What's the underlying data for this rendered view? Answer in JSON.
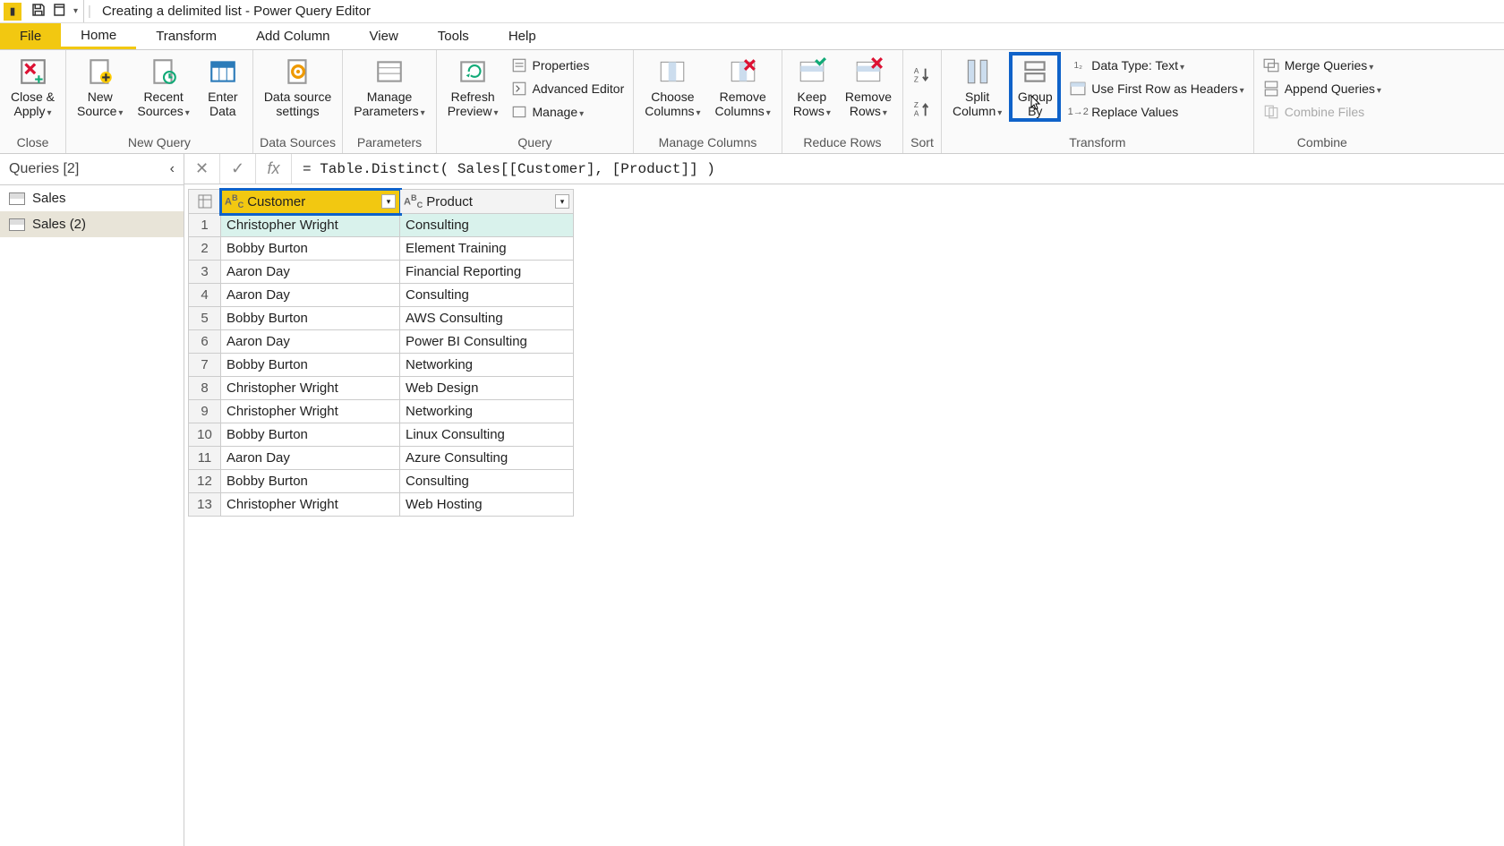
{
  "titlebar": {
    "title": "Creating a delimited list - Power Query Editor"
  },
  "tabs": {
    "file": "File",
    "home": "Home",
    "transform": "Transform",
    "addcolumn": "Add Column",
    "view": "View",
    "tools": "Tools",
    "help": "Help"
  },
  "ribbon": {
    "close": {
      "close_apply": "Close &\nApply",
      "group": "Close"
    },
    "newquery": {
      "new_source": "New\nSource",
      "recent_sources": "Recent\nSources",
      "enter_data": "Enter\nData",
      "group": "New Query"
    },
    "datasources": {
      "settings": "Data source\nsettings",
      "group": "Data Sources"
    },
    "parameters": {
      "manage": "Manage\nParameters",
      "group": "Parameters"
    },
    "query": {
      "refresh": "Refresh\nPreview",
      "properties": "Properties",
      "advanced": "Advanced Editor",
      "manage": "Manage",
      "group": "Query"
    },
    "managecols": {
      "choose": "Choose\nColumns",
      "remove": "Remove\nColumns",
      "group": "Manage Columns"
    },
    "reducerows": {
      "keep": "Keep\nRows",
      "remove": "Remove\nRows",
      "group": "Reduce Rows"
    },
    "sort": {
      "group": "Sort"
    },
    "transform": {
      "split": "Split\nColumn",
      "groupby": "Group\nBy",
      "datatype": "Data Type: Text",
      "firstrow": "Use First Row as Headers",
      "replace": "Replace Values",
      "group": "Transform"
    },
    "combine": {
      "merge": "Merge Queries",
      "append": "Append Queries",
      "files": "Combine Files",
      "group": "Combine"
    }
  },
  "formula": "= Table.Distinct( Sales[[Customer], [Product]] )",
  "sidebar": {
    "header": "Queries [2]",
    "items": [
      "Sales",
      "Sales (2)"
    ]
  },
  "grid": {
    "columns": [
      {
        "name": "Customer",
        "type": "ABC"
      },
      {
        "name": "Product",
        "type": "ABC"
      }
    ],
    "rows": [
      {
        "n": 1,
        "c": "Christopher Wright",
        "p": "Consulting"
      },
      {
        "n": 2,
        "c": "Bobby Burton",
        "p": "Element Training"
      },
      {
        "n": 3,
        "c": "Aaron Day",
        "p": "Financial Reporting"
      },
      {
        "n": 4,
        "c": "Aaron Day",
        "p": "Consulting"
      },
      {
        "n": 5,
        "c": "Bobby Burton",
        "p": "AWS Consulting"
      },
      {
        "n": 6,
        "c": "Aaron Day",
        "p": "Power BI Consulting"
      },
      {
        "n": 7,
        "c": "Bobby Burton",
        "p": "Networking"
      },
      {
        "n": 8,
        "c": "Christopher Wright",
        "p": "Web Design"
      },
      {
        "n": 9,
        "c": "Christopher Wright",
        "p": "Networking"
      },
      {
        "n": 10,
        "c": "Bobby Burton",
        "p": "Linux Consulting"
      },
      {
        "n": 11,
        "c": "Aaron Day",
        "p": "Azure Consulting"
      },
      {
        "n": 12,
        "c": "Bobby Burton",
        "p": "Consulting"
      },
      {
        "n": 13,
        "c": "Christopher Wright",
        "p": "Web Hosting"
      }
    ]
  }
}
